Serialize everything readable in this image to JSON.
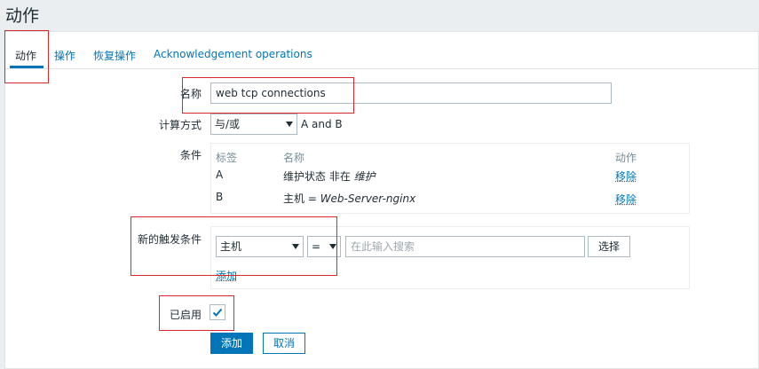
{
  "page": {
    "title": "动作"
  },
  "tabs": [
    {
      "label": "动作",
      "active": true
    },
    {
      "label": "操作",
      "active": false
    },
    {
      "label": "恢复操作",
      "active": false
    },
    {
      "label": "Acknowledgement operations",
      "active": false
    }
  ],
  "form": {
    "name_label": "名称",
    "name_value": "web tcp connections",
    "calc_label": "计算方式",
    "calc_value": "与/或",
    "calc_formula": "A and B",
    "conditions_label": "条件",
    "conditions": {
      "headers": {
        "label": "标签",
        "name": "名称",
        "action": "动作"
      },
      "rows": [
        {
          "label": "A",
          "name_prefix": "维护状态 非在 ",
          "name_italic": "维护",
          "action": "移除"
        },
        {
          "label": "B",
          "name_prefix": "主机 = ",
          "name_italic": "Web-Server-nginx",
          "action": "移除"
        }
      ]
    },
    "new_condition_label": "新的触发条件",
    "new_condition": {
      "type_value": "主机",
      "operator_value": "=",
      "search_placeholder": "在此输入搜索",
      "select_button": "选择",
      "add_link": "添加"
    },
    "enabled_label": "已启用",
    "enabled": true,
    "add_button": "添加",
    "cancel_button": "取消"
  },
  "colors": {
    "accent": "#0275b8",
    "highlight": "#d9272e",
    "background": "#ebeef0"
  }
}
